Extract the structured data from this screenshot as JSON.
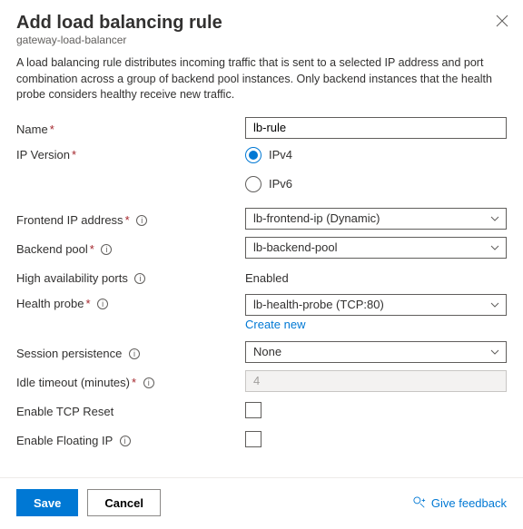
{
  "header": {
    "title": "Add load balancing rule",
    "subtitle": "gateway-load-balancer"
  },
  "description": "A load balancing rule distributes incoming traffic that is sent to a selected IP address and port combination across a group of backend pool instances. Only backend instances that the health probe considers healthy receive new traffic.",
  "fields": {
    "name": {
      "label": "Name",
      "required": true,
      "value": "lb-rule"
    },
    "ip_version": {
      "label": "IP Version",
      "required": true,
      "options": {
        "ipv4": "IPv4",
        "ipv6": "IPv6"
      },
      "selected": "ipv4"
    },
    "frontend_ip": {
      "label": "Frontend IP address",
      "required": true,
      "info": true,
      "value": "lb-frontend-ip (Dynamic)"
    },
    "backend_pool": {
      "label": "Backend pool",
      "required": true,
      "info": true,
      "value": "lb-backend-pool"
    },
    "ha_ports": {
      "label": "High availability ports",
      "info": true,
      "value": "Enabled"
    },
    "health_probe": {
      "label": "Health probe",
      "required": true,
      "info": true,
      "value": "lb-health-probe (TCP:80)",
      "create_new": "Create new"
    },
    "session_persistence": {
      "label": "Session persistence",
      "info": true,
      "value": "None"
    },
    "idle_timeout": {
      "label": "Idle timeout (minutes)",
      "required": true,
      "info": true,
      "value": "4"
    },
    "tcp_reset": {
      "label": "Enable TCP Reset",
      "checked": false
    },
    "floating_ip": {
      "label": "Enable Floating IP",
      "info": true,
      "checked": false
    }
  },
  "footer": {
    "save": "Save",
    "cancel": "Cancel",
    "feedback": "Give feedback"
  }
}
